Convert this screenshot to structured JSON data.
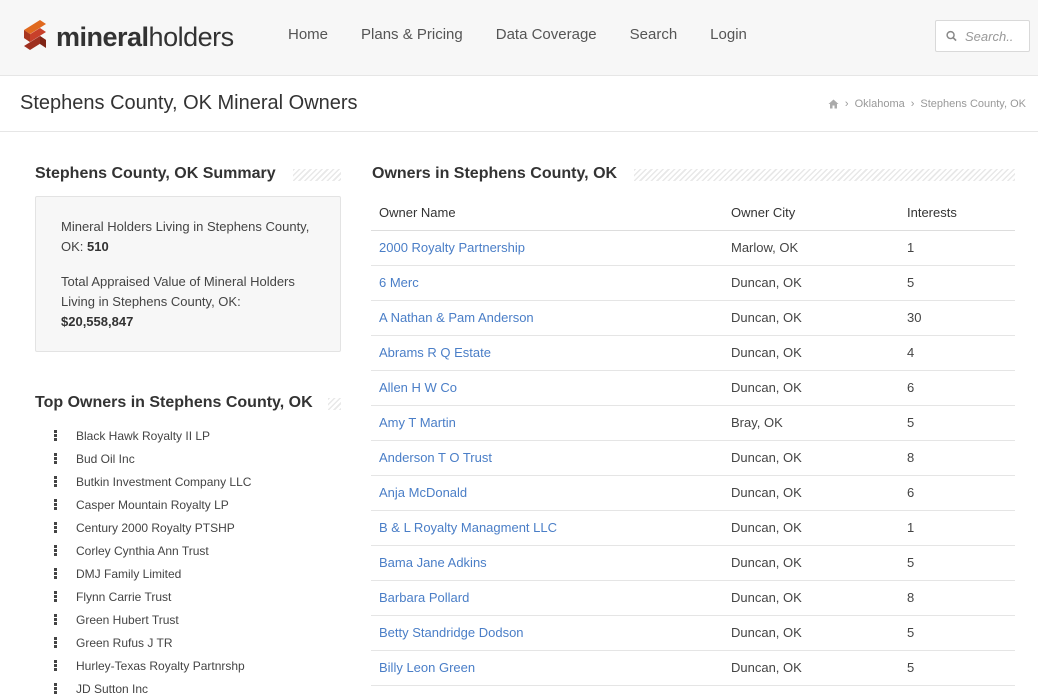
{
  "brand": {
    "logo_text_bold": "mineral",
    "logo_text_light": "holders"
  },
  "nav": [
    "Home",
    "Plans & Pricing",
    "Data Coverage",
    "Search",
    "Login"
  ],
  "search": {
    "placeholder": "Search.."
  },
  "page": {
    "title": "Stephens County, OK Mineral Owners"
  },
  "breadcrumb": [
    "Oklahoma",
    "Stephens County, OK"
  ],
  "summary": {
    "heading": "Stephens County, OK Summary",
    "residents_label": "Mineral Holders Living in Stephens County, OK:",
    "residents_value": "510",
    "value_label": "Total Appraised Value of Mineral Holders Living in Stephens County, OK:",
    "value_value": "$20,558,847"
  },
  "top_owners": {
    "heading": "Top Owners in Stephens County, OK",
    "items": [
      "Black Hawk Royalty II LP",
      "Bud Oil Inc",
      "Butkin Investment Company LLC",
      "Casper Mountain Royalty LP",
      "Century 2000 Royalty PTSHP",
      "Corley Cynthia Ann Trust",
      "DMJ Family Limited",
      "Flynn Carrie Trust",
      "Green Hubert Trust",
      "Green Rufus J TR",
      "Hurley-Texas Royalty Partnrshp",
      "JD Sutton Inc"
    ]
  },
  "owners_table": {
    "heading": "Owners in Stephens County, OK",
    "columns": [
      "Owner Name",
      "Owner City",
      "Interests"
    ],
    "rows": [
      {
        "name": "2000 Royalty Partnership",
        "city": "Marlow, OK",
        "interests": "1"
      },
      {
        "name": "6 Merc",
        "city": "Duncan, OK",
        "interests": "5"
      },
      {
        "name": "A Nathan & Pam Anderson",
        "city": "Duncan, OK",
        "interests": "30"
      },
      {
        "name": "Abrams R Q Estate",
        "city": "Duncan, OK",
        "interests": "4"
      },
      {
        "name": "Allen H W Co",
        "city": "Duncan, OK",
        "interests": "6"
      },
      {
        "name": "Amy T Martin",
        "city": "Bray, OK",
        "interests": "5"
      },
      {
        "name": "Anderson T O Trust",
        "city": "Duncan, OK",
        "interests": "8"
      },
      {
        "name": "Anja McDonald",
        "city": "Duncan, OK",
        "interests": "6"
      },
      {
        "name": "B & L Royalty Managment LLC",
        "city": "Duncan, OK",
        "interests": "1"
      },
      {
        "name": "Bama Jane Adkins",
        "city": "Duncan, OK",
        "interests": "5"
      },
      {
        "name": "Barbara Pollard",
        "city": "Duncan, OK",
        "interests": "8"
      },
      {
        "name": "Betty Standridge Dodson",
        "city": "Duncan, OK",
        "interests": "5"
      },
      {
        "name": "Billy Leon Green",
        "city": "Duncan, OK",
        "interests": "5"
      }
    ]
  },
  "colors": {
    "link": "#4a7ec7",
    "logo_red": "#c8402a",
    "logo_orange": "#e0691f"
  }
}
